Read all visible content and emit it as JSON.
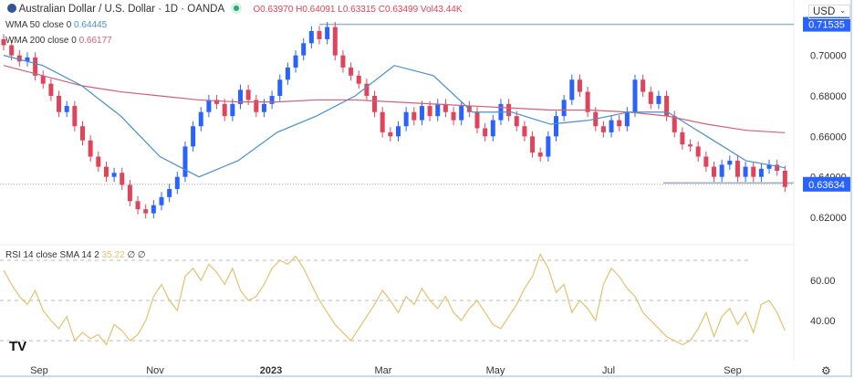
{
  "header": {
    "symbol": "Australian Dollar / U.S. Dollar · 1D · OANDA",
    "o_label": "O",
    "o": "0.63970",
    "h_label": "H",
    "h": "0.64091",
    "l_label": "L",
    "l": "0.63315",
    "c_label": "C",
    "c": "0.63499",
    "vol_label": "Vol",
    "vol": "43.44K",
    "currency": "USD"
  },
  "indicators": {
    "wma50": "WMA 50 close 0",
    "wma50_val": "0.64445",
    "wma200": "WMA 200 close 0",
    "wma200_val": "0.66177",
    "rsi": "RSI 14 close SMA 14 2",
    "rsi_val": "35.22",
    "rsi_extra": "∅ ∅"
  },
  "colors": {
    "up": "#2962ff",
    "down": "#e0445a",
    "wma50": "#4a90c8",
    "wma200": "#d0607a",
    "rsi": "#e3c16f",
    "label": "#2962ff"
  },
  "chart_data": [
    {
      "type": "candlestick",
      "title": "Australian Dollar / U.S. Dollar · 1D · OANDA",
      "ylim": [
        0.61,
        0.72
      ],
      "y_ticks": [
        "0.70000",
        "0.68000",
        "0.66000",
        "0.64000",
        "0.62000"
      ],
      "x_ticks": [
        "Sep",
        "Nov",
        "2023",
        "Mar",
        "May",
        "Jul",
        "Sep"
      ],
      "price_labels": {
        "high": "0.71535",
        "current": "0.63634"
      },
      "closes": [
        0.705,
        0.7,
        0.697,
        0.699,
        0.69,
        0.686,
        0.68,
        0.672,
        0.675,
        0.665,
        0.658,
        0.65,
        0.645,
        0.64,
        0.642,
        0.636,
        0.628,
        0.624,
        0.622,
        0.626,
        0.63,
        0.634,
        0.64,
        0.655,
        0.665,
        0.672,
        0.678,
        0.676,
        0.67,
        0.676,
        0.683,
        0.678,
        0.672,
        0.676,
        0.68,
        0.688,
        0.694,
        0.7,
        0.706,
        0.712,
        0.708,
        0.714,
        0.7,
        0.694,
        0.69,
        0.686,
        0.68,
        0.672,
        0.662,
        0.66,
        0.665,
        0.672,
        0.668,
        0.675,
        0.67,
        0.676,
        0.672,
        0.668,
        0.675,
        0.672,
        0.664,
        0.66,
        0.668,
        0.676,
        0.67,
        0.665,
        0.66,
        0.652,
        0.65,
        0.66,
        0.67,
        0.678,
        0.688,
        0.682,
        0.672,
        0.665,
        0.662,
        0.668,
        0.665,
        0.672,
        0.688,
        0.682,
        0.676,
        0.68,
        0.67,
        0.662,
        0.656,
        0.655,
        0.65,
        0.645,
        0.64,
        0.646,
        0.648,
        0.64,
        0.645,
        0.64,
        0.644,
        0.646,
        0.643,
        0.635
      ],
      "wma50": [
        0.7,
        0.695,
        0.685,
        0.67,
        0.65,
        0.64,
        0.648,
        0.662,
        0.67,
        0.68,
        0.695,
        0.69,
        0.672,
        0.672,
        0.666,
        0.668,
        0.672,
        0.672,
        0.66,
        0.648,
        0.6445
      ],
      "wma200": [
        0.695,
        0.69,
        0.685,
        0.682,
        0.68,
        0.678,
        0.677,
        0.677,
        0.678,
        0.678,
        0.677,
        0.676,
        0.675,
        0.674,
        0.673,
        0.673,
        0.672,
        0.67,
        0.666,
        0.663,
        0.6618
      ]
    },
    {
      "type": "line",
      "title": "RSI 14",
      "ylim": [
        20,
        80
      ],
      "y_ticks": [
        "60.00",
        "40.00"
      ],
      "bands": [
        70,
        50,
        30
      ],
      "values": [
        65,
        58,
        52,
        48,
        55,
        45,
        40,
        36,
        42,
        30,
        34,
        31,
        33,
        28,
        38,
        35,
        30,
        33,
        40,
        52,
        58,
        50,
        45,
        62,
        66,
        60,
        68,
        64,
        58,
        66,
        55,
        50,
        52,
        58,
        66,
        70,
        68,
        72,
        66,
        58,
        50,
        44,
        38,
        34,
        30,
        36,
        42,
        48,
        55,
        50,
        44,
        52,
        48,
        56,
        50,
        46,
        52,
        44,
        40,
        46,
        50,
        44,
        38,
        36,
        42,
        48,
        56,
        62,
        73,
        66,
        54,
        58,
        44,
        50,
        46,
        40,
        58,
        66,
        62,
        56,
        52,
        44,
        40,
        36,
        32,
        30,
        28,
        30,
        36,
        44,
        32,
        42,
        46,
        38,
        44,
        34,
        48,
        50,
        44,
        35
      ]
    }
  ]
}
